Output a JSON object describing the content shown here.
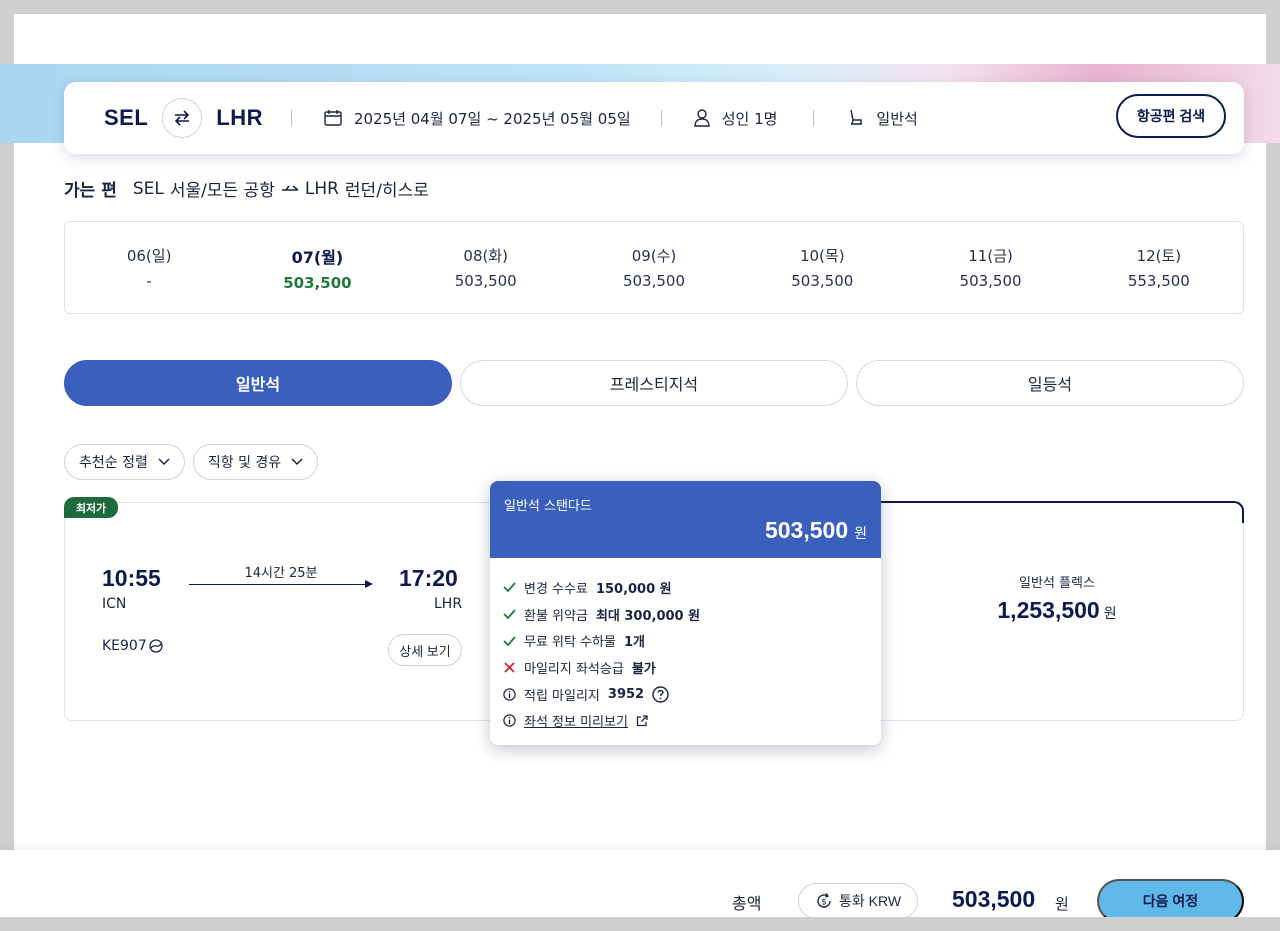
{
  "search": {
    "origin": "SEL",
    "destination": "LHR",
    "dates": "2025년 04월 07일 ~ 2025년 05월 05일",
    "passengers": "성인 1명",
    "cabin": "일반석",
    "search_button": "항공편 검색"
  },
  "route": {
    "label": "가는 편",
    "origin_code": "SEL",
    "origin_name": "서울/모든 공항",
    "dest_code": "LHR",
    "dest_name": "런던/히스로"
  },
  "dates": [
    {
      "day": "06(일)",
      "price": "-"
    },
    {
      "day": "07(월)",
      "price": "503,500",
      "selected": true
    },
    {
      "day": "08(화)",
      "price": "503,500"
    },
    {
      "day": "09(수)",
      "price": "503,500"
    },
    {
      "day": "10(목)",
      "price": "503,500"
    },
    {
      "day": "11(금)",
      "price": "503,500"
    },
    {
      "day": "12(토)",
      "price": "553,500"
    }
  ],
  "cabin_tabs": [
    "일반석",
    "프레스티지석",
    "일등석"
  ],
  "filters": {
    "sort": "추천순 정렬",
    "stops": "직항 및 경유"
  },
  "flight": {
    "badge": "최저가",
    "depart_time": "10:55",
    "depart_airport": "ICN",
    "duration": "14시간 25분",
    "arrive_time": "17:20",
    "arrive_airport": "LHR",
    "flight_number": "KE907",
    "detail_button": "상세 보기",
    "flex_fare_name": "일반석 플렉스",
    "flex_fare_amount": "1,253,500",
    "currency_unit": "원"
  },
  "popup": {
    "title": "일반석 스탠다드",
    "amount": "503,500",
    "unit": "원",
    "rows": {
      "change_fee_label": "변경 수수료",
      "change_fee_value": "150,000 원",
      "refund_label": "환불 위약금",
      "refund_value": "최대 300,000 원",
      "baggage_label": "무료 위탁 수하물",
      "baggage_value": "1개",
      "upgrade_label": "마일리지 좌석승급",
      "upgrade_value": "불가",
      "mileage_label": "적립 마일리지",
      "mileage_value": "3952",
      "seat_preview": "좌석 정보 미리보기"
    }
  },
  "footer": {
    "total_label": "총액",
    "currency_button": "통화 KRW",
    "total_amount": "503,500",
    "total_unit": "원",
    "next_button": "다음 여정"
  },
  "colors": {
    "brand_navy": "#0b1a4f",
    "active_blue": "#3a5fbc",
    "lowest_green": "#1d6b3c",
    "next_button": "#5fb8e8"
  }
}
